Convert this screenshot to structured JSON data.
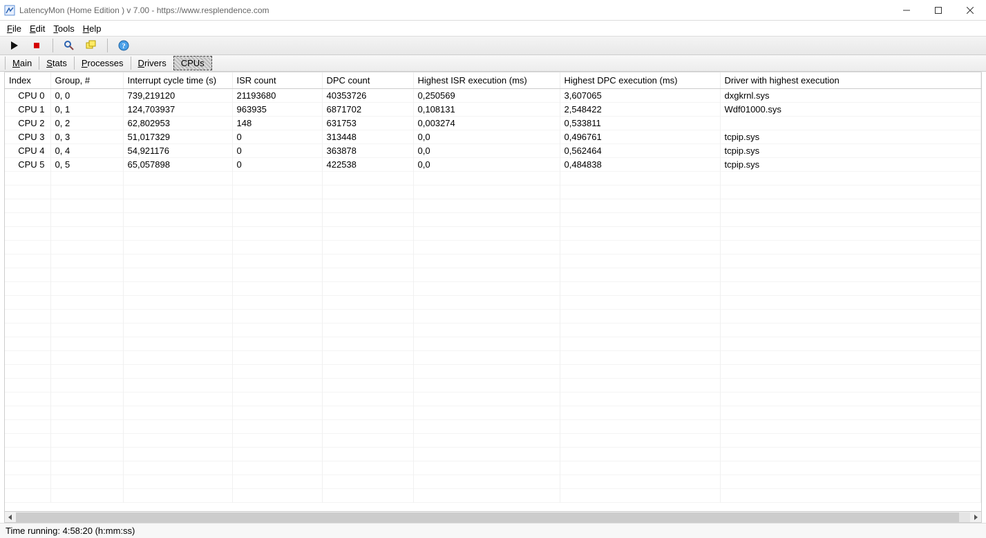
{
  "window": {
    "title": "LatencyMon  (Home Edition )  v 7.00 - https://www.resplendence.com"
  },
  "menu": {
    "file": "File",
    "edit": "Edit",
    "tools": "Tools",
    "help": "Help"
  },
  "toolbar": {
    "play": "play-icon",
    "stop": "stop-icon",
    "search": "search-icon",
    "windows": "windows-icon",
    "help": "help-icon"
  },
  "tabs": {
    "main": "Main",
    "stats": "Stats",
    "processes": "Processes",
    "drivers": "Drivers",
    "cpus": "CPUs"
  },
  "columns": {
    "index": "Index",
    "group": "Group, #",
    "interrupt": "Interrupt cycle time (s)",
    "isr": "ISR count",
    "dpc": "DPC count",
    "hisr": "Highest ISR execution (ms)",
    "hdpc": "Highest DPC execution (ms)",
    "driver": "Driver with highest execution"
  },
  "rows": [
    {
      "index": "CPU 0",
      "group": "0, 0",
      "interrupt": "739,219120",
      "isr": "21193680",
      "dpc": "40353726",
      "hisr": "0,250569",
      "hdpc": "3,607065",
      "driver": "dxgkrnl.sys"
    },
    {
      "index": "CPU 1",
      "group": "0, 1",
      "interrupt": "124,703937",
      "isr": "963935",
      "dpc": "6871702",
      "hisr": "0,108131",
      "hdpc": "2,548422",
      "driver": "Wdf01000.sys"
    },
    {
      "index": "CPU 2",
      "group": "0, 2",
      "interrupt": "62,802953",
      "isr": "148",
      "dpc": "631753",
      "hisr": "0,003274",
      "hdpc": "0,533811",
      "driver": ""
    },
    {
      "index": "CPU 3",
      "group": "0, 3",
      "interrupt": "51,017329",
      "isr": "0",
      "dpc": "313448",
      "hisr": "0,0",
      "hdpc": "0,496761",
      "driver": "tcpip.sys"
    },
    {
      "index": "CPU 4",
      "group": "0, 4",
      "interrupt": "54,921176",
      "isr": "0",
      "dpc": "363878",
      "hisr": "0,0",
      "hdpc": "0,562464",
      "driver": "tcpip.sys"
    },
    {
      "index": "CPU 5",
      "group": "0, 5",
      "interrupt": "65,057898",
      "isr": "0",
      "dpc": "422538",
      "hisr": "0,0",
      "hdpc": "0,484838",
      "driver": "tcpip.sys"
    }
  ],
  "status": {
    "text": "Time running: 4:58:20  (h:mm:ss)"
  }
}
